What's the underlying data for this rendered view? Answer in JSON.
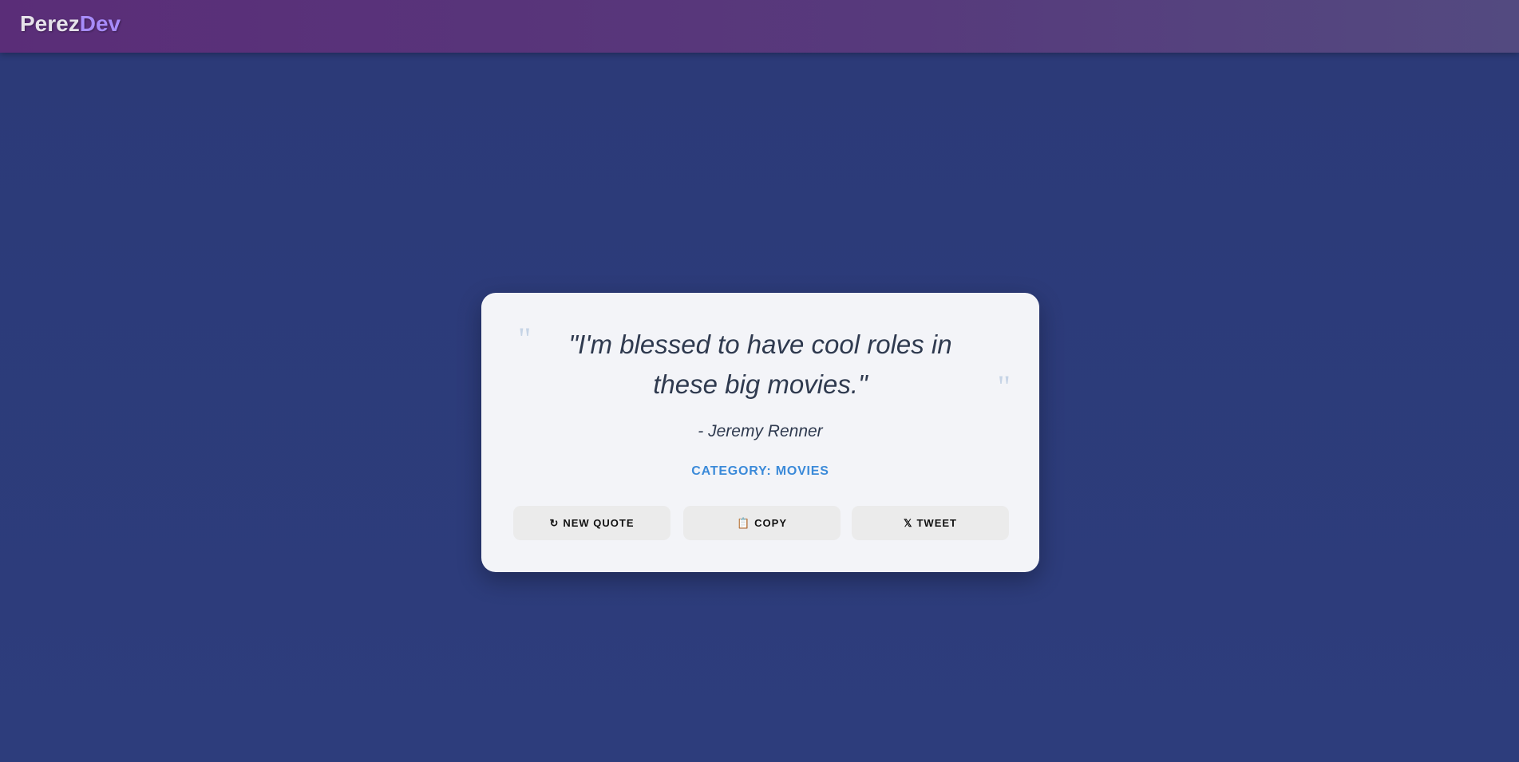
{
  "header": {
    "logo_part1": "Perez",
    "logo_part2": "Dev",
    "logo_color_accent": "#a78bfa"
  },
  "card": {
    "open_quote_mark": "\"",
    "close_quote_mark": "\"",
    "quote": "\"I'm blessed to have cool roles in these big movies.\"",
    "author": "- Jeremy Renner",
    "category": "CATEGORY: MOVIES",
    "buttons": [
      {
        "icon": "↻",
        "label": "NEW QUOTE"
      },
      {
        "icon": "📋",
        "label": "COPY"
      },
      {
        "icon": "𝕏",
        "label": "TWEET"
      }
    ]
  }
}
